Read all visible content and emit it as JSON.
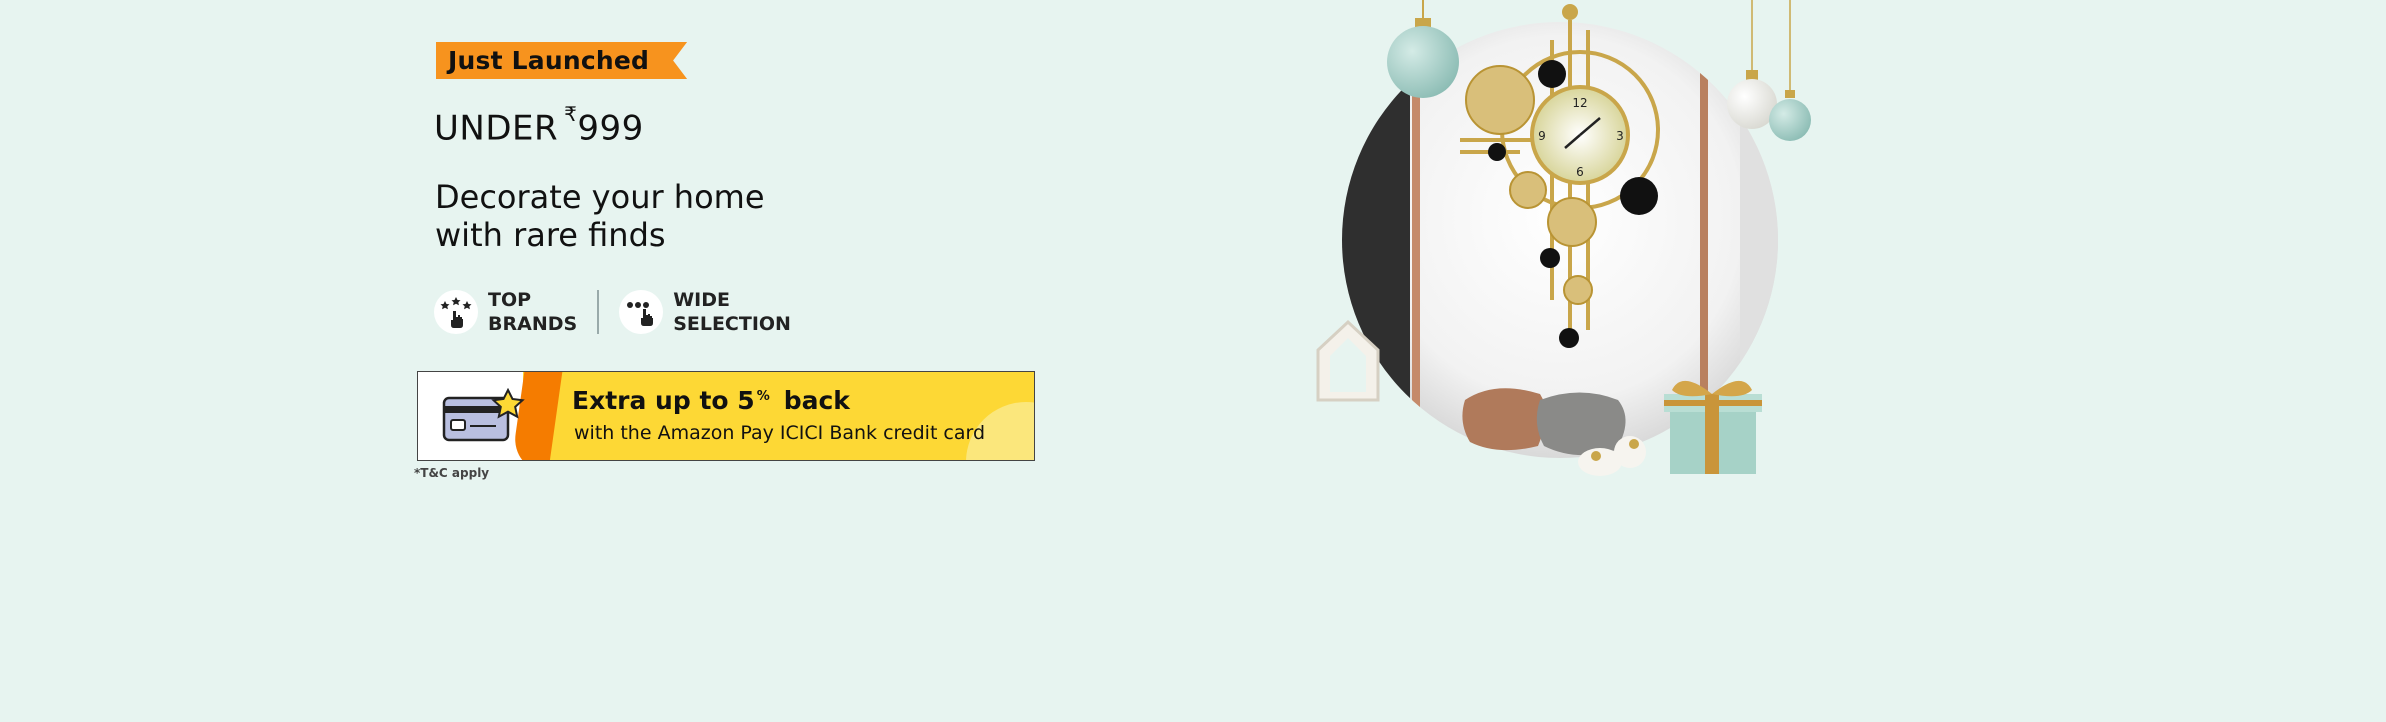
{
  "badge": {
    "label": "Just Launched"
  },
  "price": {
    "prefix": "UNDER",
    "currency": "₹",
    "amount": "999"
  },
  "headline": {
    "line1": "Decorate your home",
    "line2": "with rare finds"
  },
  "features": [
    {
      "line1": "TOP",
      "line2": "BRANDS",
      "icon": "star-hand-icon"
    },
    {
      "line1": "WIDE",
      "line2": "SELECTION",
      "icon": "dots-hand-icon"
    }
  ],
  "offer": {
    "title_prefix": "Extra up to 5",
    "title_sup": "%",
    "title_suffix": "back",
    "subtitle": "with the Amazon Pay ICICI Bank credit card",
    "icon": "credit-card-star-icon"
  },
  "tnc": "*T&C apply",
  "clock": {
    "n12": "12",
    "n3": "3",
    "n6": "6",
    "n9": "9"
  },
  "colors": {
    "background": "#e7f4f0",
    "badge": "#f7931e",
    "offer_yellow": "#fdd835",
    "offer_orange": "#f57c00"
  }
}
